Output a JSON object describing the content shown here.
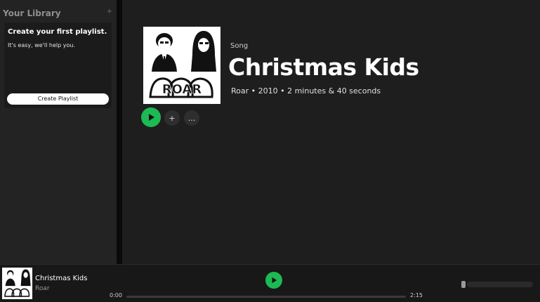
{
  "sidebar": {
    "title": "Your Library",
    "add_icon": "plus-icon",
    "promo": {
      "title": "Create your first playlist.",
      "subtitle": "It's easy, we'll help you.",
      "button_label": "Create Playlist"
    }
  },
  "song": {
    "type_label": "Song",
    "title": "Christmas Kids",
    "meta": "Roar • 2010 • 2 minutes & 40 seconds",
    "cover_art_text": "ROAR",
    "actions": {
      "play_icon": "play-icon",
      "add_label": "+",
      "more_label": "..."
    }
  },
  "player": {
    "track_title": "Christmas Kids",
    "artist": "Roar",
    "time_current": "0:00",
    "time_total": "2:15",
    "progress": 0,
    "play_icon": "play-icon",
    "volume_icon": "volume-slider"
  },
  "colors": {
    "accent": "#1db954",
    "background": "#1e1e1e",
    "sidebar": "#232323"
  }
}
